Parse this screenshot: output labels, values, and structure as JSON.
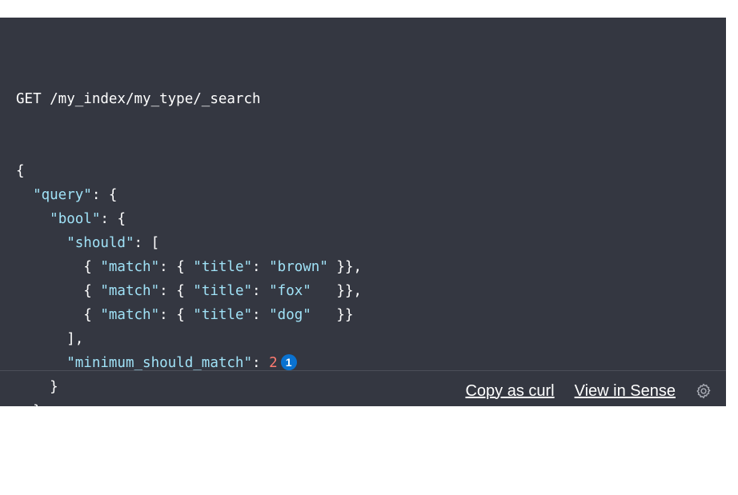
{
  "code": {
    "request_line": "GET /my_index/my_type/_search",
    "lines": [
      [
        {
          "t": "{",
          "c": ""
        }
      ],
      [
        {
          "t": "  ",
          "c": ""
        },
        {
          "t": "\"query\"",
          "c": "k"
        },
        {
          "t": ": {",
          "c": ""
        }
      ],
      [
        {
          "t": "    ",
          "c": ""
        },
        {
          "t": "\"bool\"",
          "c": "k"
        },
        {
          "t": ": {",
          "c": ""
        }
      ],
      [
        {
          "t": "      ",
          "c": ""
        },
        {
          "t": "\"should\"",
          "c": "k"
        },
        {
          "t": ": [",
          "c": ""
        }
      ],
      [
        {
          "t": "        { ",
          "c": ""
        },
        {
          "t": "\"match\"",
          "c": "k"
        },
        {
          "t": ": { ",
          "c": ""
        },
        {
          "t": "\"title\"",
          "c": "k"
        },
        {
          "t": ": ",
          "c": ""
        },
        {
          "t": "\"brown\"",
          "c": "k"
        },
        {
          "t": " }},",
          "c": ""
        }
      ],
      [
        {
          "t": "        { ",
          "c": ""
        },
        {
          "t": "\"match\"",
          "c": "k"
        },
        {
          "t": ": { ",
          "c": ""
        },
        {
          "t": "\"title\"",
          "c": "k"
        },
        {
          "t": ": ",
          "c": ""
        },
        {
          "t": "\"fox\"",
          "c": "k"
        },
        {
          "t": "   }},",
          "c": ""
        }
      ],
      [
        {
          "t": "        { ",
          "c": ""
        },
        {
          "t": "\"match\"",
          "c": "k"
        },
        {
          "t": ": { ",
          "c": ""
        },
        {
          "t": "\"title\"",
          "c": "k"
        },
        {
          "t": ": ",
          "c": ""
        },
        {
          "t": "\"dog\"",
          "c": "k"
        },
        {
          "t": "   }}",
          "c": ""
        }
      ],
      [
        {
          "t": "      ],",
          "c": ""
        }
      ],
      [
        {
          "t": "      ",
          "c": ""
        },
        {
          "t": "\"minimum_should_match\"",
          "c": "k"
        },
        {
          "t": ": ",
          "c": ""
        },
        {
          "t": "2",
          "c": "n"
        },
        {
          "t": "1",
          "c": "callout"
        }
      ],
      [
        {
          "t": "    }",
          "c": ""
        }
      ],
      [
        {
          "t": "  }",
          "c": ""
        }
      ],
      [
        {
          "t": "}",
          "c": ""
        }
      ]
    ]
  },
  "footer": {
    "copy_as_curl": "Copy as curl",
    "view_in_sense": "View in Sense",
    "settings_icon": "gear-icon"
  },
  "colors": {
    "background": "#343741",
    "key": "#a0e2f7",
    "number": "#ff7b70",
    "callout": "#0a72d0"
  }
}
